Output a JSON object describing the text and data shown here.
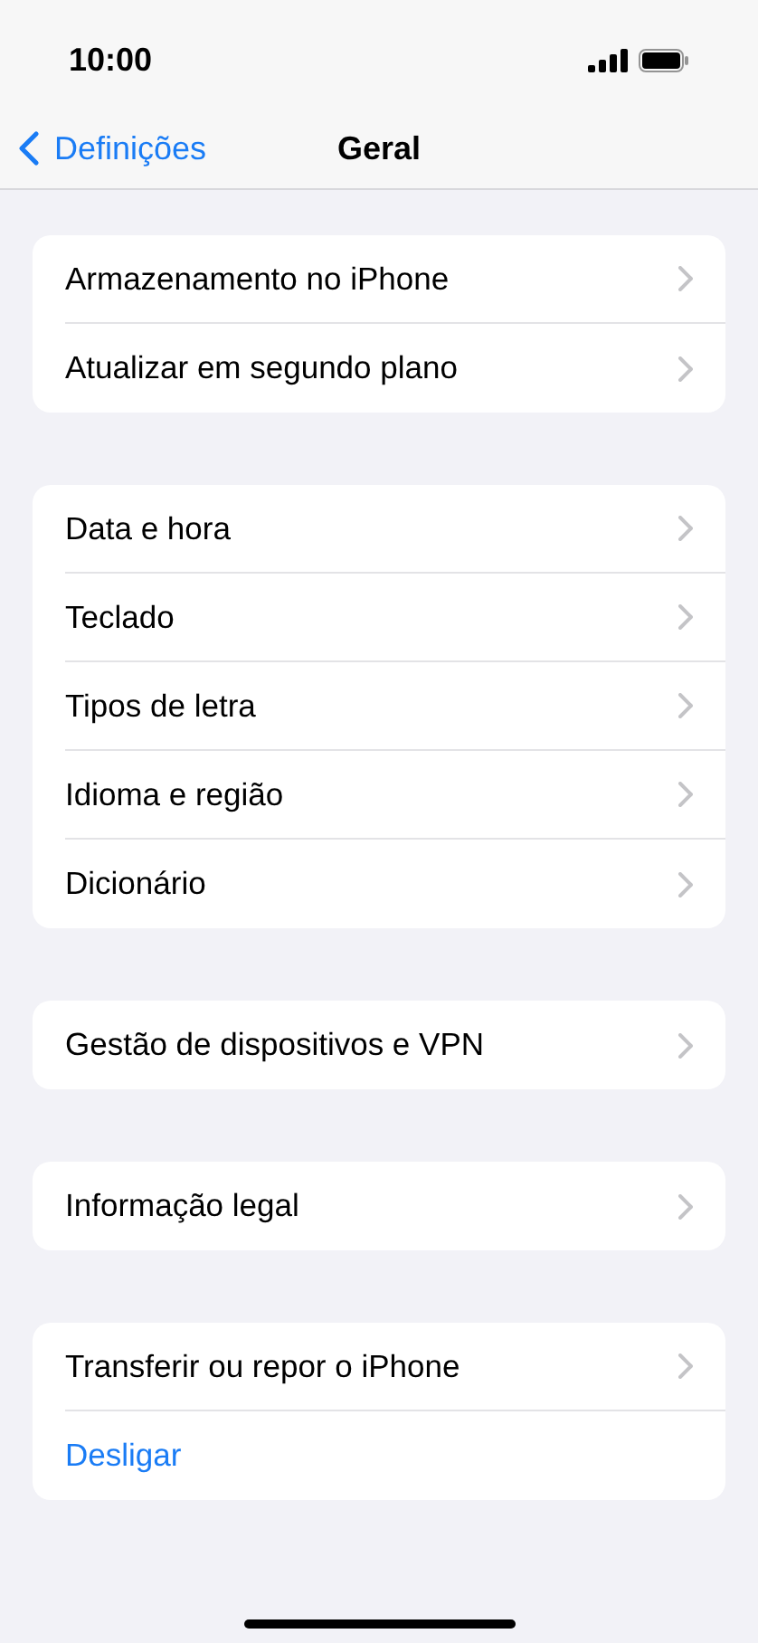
{
  "status_bar": {
    "time": "10:00"
  },
  "nav": {
    "back_label": "Definições",
    "title": "Geral"
  },
  "groups": [
    {
      "items": [
        {
          "label": "Armazenamento no iPhone",
          "kind": "link"
        },
        {
          "label": "Atualizar em segundo plano",
          "kind": "link"
        }
      ]
    },
    {
      "items": [
        {
          "label": "Data e hora",
          "kind": "link"
        },
        {
          "label": "Teclado",
          "kind": "link"
        },
        {
          "label": "Tipos de letra",
          "kind": "link"
        },
        {
          "label": "Idioma e região",
          "kind": "link"
        },
        {
          "label": "Dicionário",
          "kind": "link"
        }
      ]
    },
    {
      "items": [
        {
          "label": "Gestão de dispositivos e VPN",
          "kind": "link"
        }
      ]
    },
    {
      "items": [
        {
          "label": "Informação legal",
          "kind": "link"
        }
      ]
    },
    {
      "items": [
        {
          "label": "Transferir ou repor o iPhone",
          "kind": "link"
        },
        {
          "label": "Desligar",
          "kind": "action"
        }
      ]
    }
  ]
}
